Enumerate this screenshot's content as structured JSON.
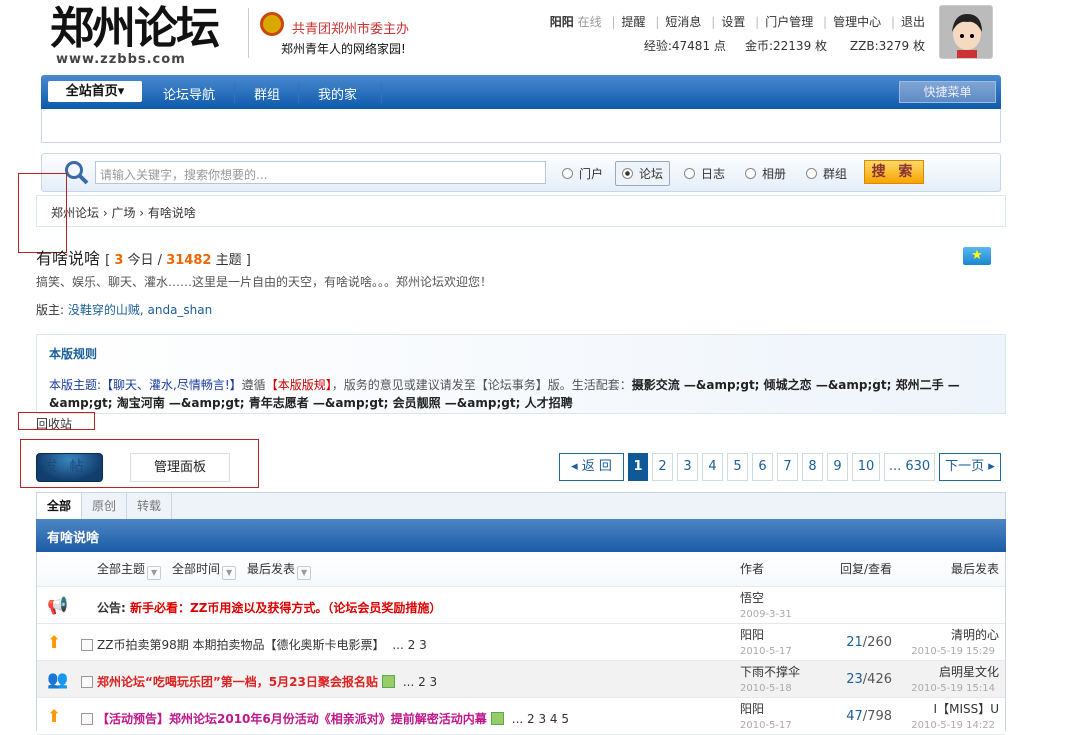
{
  "header": {
    "logo": "郑州论坛",
    "logo_url": "www.zzbbs.com",
    "org": "共青团郑州市委主办",
    "slogan": "郑州青年人的网络家园!",
    "user": {
      "name": "阳阳",
      "status": "在线",
      "links": [
        "提醒",
        "短消息",
        "设置",
        "门户管理",
        "管理中心",
        "退出"
      ],
      "exp": "经验:47481 点",
      "gold": "金币:22139 枚",
      "zzb": "ZZB:3279 枚"
    }
  },
  "nav": {
    "home": "全站首页▾",
    "items": [
      "论坛导航",
      "群组",
      "我的家"
    ],
    "quick": "快捷菜单"
  },
  "search": {
    "placeholder": "请输入关键字，搜索你想要的...",
    "options": [
      "门户",
      "论坛",
      "日志",
      "相册",
      "群组"
    ],
    "selected": "论坛",
    "button": "搜 索"
  },
  "breadcrumb": [
    "郑州论坛",
    "广场",
    "有啥说啥"
  ],
  "forum": {
    "name": "有啥说啥",
    "today": "3",
    "today_label": "今日",
    "topics": "31482",
    "topics_label": "主题",
    "description": "搞笑、娱乐、聊天、灌水……这里是一片自由的天空，有啥说啥。。。郑州论坛欢迎您！",
    "moderators_label": "版主:",
    "moderators": "没鞋穿的山贼, anda_shan"
  },
  "rules": {
    "title": "本版规则",
    "theme": "本版主题:【聊天、灌水,尽情畅言!】",
    "follow": "遵循",
    "rule_link": "【本版版规】",
    "mid": "，版务的意见或建议请发至【论坛事务】版。生活配套：",
    "links": "摄影交流 —&amp;gt; 倾城之恋 —&amp;gt; 郑州二手 —&amp;gt; 淘宝河南 —&amp;gt; 青年志愿者 —&amp;gt; 会员靓照 —&amp;gt; 人才招聘"
  },
  "recycle": "回收站",
  "actions": {
    "post": "发帖",
    "manage": "管理面板"
  },
  "pagination": {
    "back": "◂ 返 回",
    "pages": [
      "1",
      "2",
      "3",
      "4",
      "5",
      "6",
      "7",
      "8",
      "9",
      "10"
    ],
    "current": "1",
    "last": "... 630",
    "next": "下一页 ▸"
  },
  "tabs": [
    "全部",
    "原创",
    "转载"
  ],
  "table": {
    "title": "有啥说啥",
    "filters": [
      "全部主题",
      "全部时间",
      "最后发表"
    ],
    "col_author": "作者",
    "col_rv": "回复/查看",
    "col_last": "最后发表",
    "announcement": {
      "prefix": "公告:",
      "title": "新手必看：ZZ币用途以及获得方式。（论坛会员奖励措施）",
      "author": "悟空",
      "date": "2009-3-31"
    },
    "rows": [
      {
        "title": "ZZ币拍卖第98期 本期拍卖物品【德化奥斯卡电影票】",
        "pages": "... 2  3",
        "author": "阳阳",
        "date": "2010-5-17",
        "replies": "21",
        "views": "/260",
        "last_user": "清明的心",
        "last_date": "2010-5-19 15:29"
      },
      {
        "title": "郑州论坛“吃喝玩乐团”第一档，5月23日聚会报名贴",
        "pages": "... 2  3",
        "author": "下雨不撑伞",
        "date": "2010-5-18",
        "replies": "23",
        "views": "/426",
        "last_user": "启明星文化",
        "last_date": "2010-5-19 15:14"
      },
      {
        "title": "【活动预告】郑州论坛2010年6月份活动《相亲派对》提前解密活动内幕",
        "pages": "... 2  3  4  5",
        "author": "阳阳",
        "date": "2010-5-17",
        "replies": "47",
        "views": "/798",
        "last_user": "I【MISS】U",
        "last_date": "2010-5-19 14:22"
      }
    ]
  }
}
